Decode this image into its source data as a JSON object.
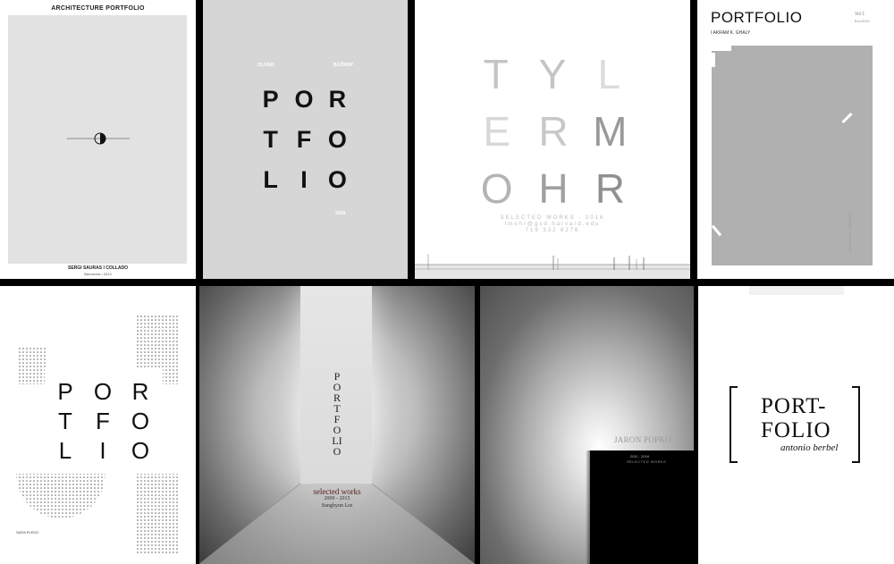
{
  "c1": {
    "title": "ARCHITECTURE PORTFOLIO",
    "author": "SERGI SAURAS I COLLADO",
    "sub": "Barcelona • 2013"
  },
  "c2": {
    "first": "OLIVER",
    "last": "BAŽĪNSP",
    "l1": [
      "P",
      "O",
      "R"
    ],
    "l2": [
      "T",
      "F",
      "O"
    ],
    "l3": [
      "L",
      "I",
      "O"
    ],
    "year": "2018"
  },
  "c3": {
    "l1": [
      "T",
      "Y",
      "L"
    ],
    "l2": [
      "E",
      "R",
      "M"
    ],
    "l3": [
      "O",
      "H",
      "R"
    ],
    "works": "SELECTED WORKS - 2016",
    "email": "tmohr@gsd.harvard.edu",
    "phone": "719 332 8276"
  },
  "c4": {
    "title": "PORTFOLIO",
    "vol": "Vol 1",
    "vol_sub": "Ed.XXXX",
    "author": "I AKRAM K. GHALY",
    "side": "ACADEMIC WORKS"
  },
  "c5": {
    "l1": [
      "P",
      "O",
      "R"
    ],
    "l2": [
      "T",
      "F",
      "O"
    ],
    "l3": [
      "L",
      "I",
      "O"
    ],
    "author": "SARA PLEDO"
  },
  "c6": {
    "vertical": "PORTFOLIO",
    "works": "selected works",
    "years": "2009 - 2015",
    "author": "Sunghyun Lee"
  },
  "c7": {
    "name": "JARON POPKO",
    "years": "2011 - 2016",
    "sub": "SELECTED WORKS"
  },
  "c8": {
    "l1": "PORT-",
    "l2": "FOLIO",
    "author": "antonio berbel"
  }
}
